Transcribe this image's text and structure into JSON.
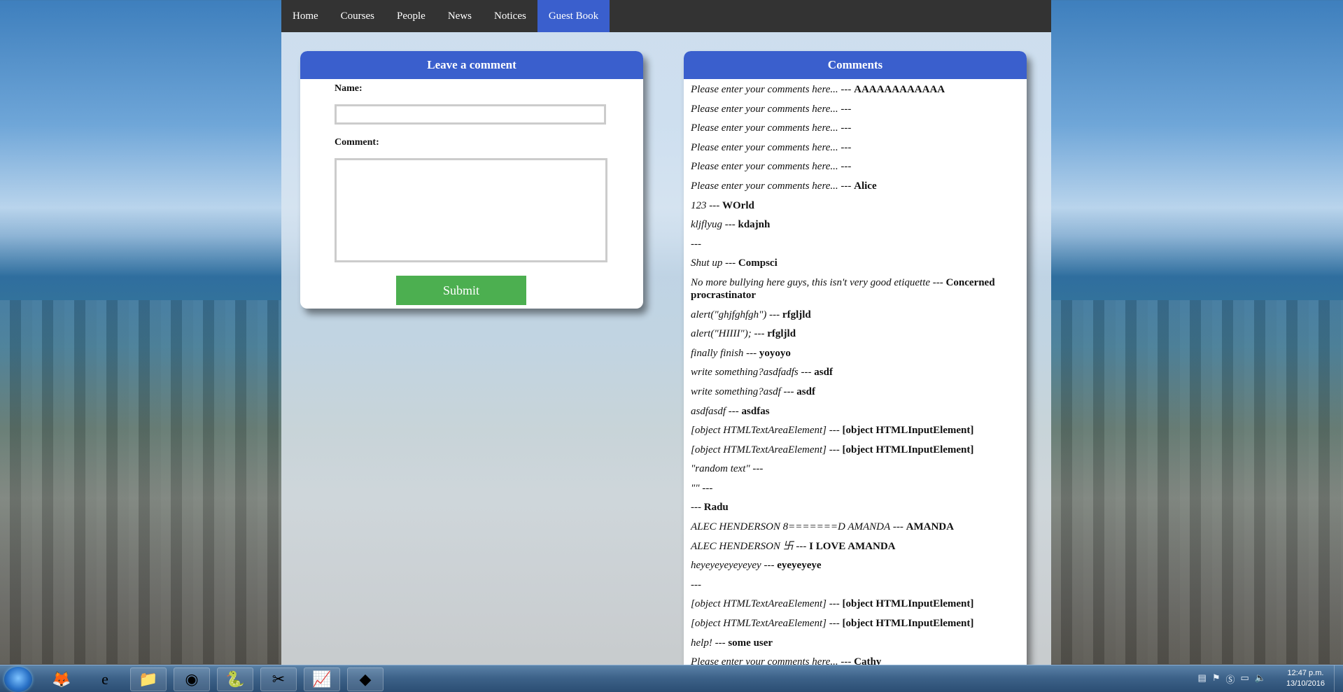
{
  "nav": {
    "items": [
      "Home",
      "Courses",
      "People",
      "News",
      "Notices",
      "Guest Book"
    ],
    "active": "Guest Book"
  },
  "leave_comment": {
    "title": "Leave a comment",
    "name_label": "Name:",
    "name_value": "",
    "comment_label": "Comment:",
    "comment_value": "",
    "submit_label": "Submit"
  },
  "comments": {
    "title": "Comments",
    "items": [
      {
        "text": "Please enter your comments here...",
        "sep": " --- ",
        "author": "AAAAAAAAAAAA"
      },
      {
        "text": "Please enter your comments here...",
        "sep": " --- ",
        "author": ""
      },
      {
        "text": "Please enter your comments here...",
        "sep": " --- ",
        "author": ""
      },
      {
        "text": "Please enter your comments here...",
        "sep": " --- ",
        "author": ""
      },
      {
        "text": "Please enter your comments here...",
        "sep": " --- ",
        "author": ""
      },
      {
        "text": "Please enter your comments here...",
        "sep": " --- ",
        "author": "Alice"
      },
      {
        "text": "123",
        "sep": " --- ",
        "author": "WOrld"
      },
      {
        "text": "kljflyug",
        "sep": " --- ",
        "author": "kdajnh"
      },
      {
        "text": "",
        "sep": " --- ",
        "author": ""
      },
      {
        "text": "Shut up",
        "sep": " --- ",
        "author": "Compsci"
      },
      {
        "text": "No more bullying here guys, this isn't very good etiquette",
        "sep": " --- ",
        "author": "Concerned procrastinator"
      },
      {
        "text": "alert(\"ghjfghfgh\")",
        "sep": " --- ",
        "author": "rfgljld"
      },
      {
        "text": "alert(\"HIIII\");",
        "sep": " --- ",
        "author": "rfgljld"
      },
      {
        "text": "finally finish",
        "sep": " --- ",
        "author": "yoyoyo"
      },
      {
        "text": "write something?asdfadfs",
        "sep": " --- ",
        "author": "asdf"
      },
      {
        "text": "write something?asdf",
        "sep": " --- ",
        "author": "asdf"
      },
      {
        "text": "asdfasdf",
        "sep": " --- ",
        "author": "asdfas"
      },
      {
        "text": "[object HTMLTextAreaElement]",
        "sep": " --- ",
        "author": "[object HTMLInputElement]"
      },
      {
        "text": "[object HTMLTextAreaElement]",
        "sep": " --- ",
        "author": "[object HTMLInputElement]"
      },
      {
        "text": "\"random text\"",
        "sep": " --- ",
        "author": ""
      },
      {
        "text": "\"\"",
        "sep": " --- ",
        "author": ""
      },
      {
        "text": "",
        "sep": " --- ",
        "author": "Radu"
      },
      {
        "text": "ALEC HENDERSON 8=======D AMANDA",
        "sep": " --- ",
        "author": "AMANDA"
      },
      {
        "text": "ALEC HENDERSON 卐",
        "sep": " --- ",
        "author": "I LOVE AMANDA"
      },
      {
        "text": "heyeyeyeyeyeyey",
        "sep": " --- ",
        "author": "eyeyeyeye"
      },
      {
        "text": "",
        "sep": " --- ",
        "author": ""
      },
      {
        "text": "[object HTMLTextAreaElement]",
        "sep": " --- ",
        "author": "[object HTMLInputElement]"
      },
      {
        "text": "[object HTMLTextAreaElement]",
        "sep": " --- ",
        "author": "[object HTMLInputElement]"
      },
      {
        "text": "help!",
        "sep": " --- ",
        "author": "some user"
      },
      {
        "text": "Please enter your comments here...",
        "sep": " --- ",
        "author": "Cathy"
      }
    ]
  },
  "taskbar": {
    "apps": [
      {
        "icon": "firefox-icon",
        "glyph": "🦊"
      },
      {
        "icon": "internet-explorer-icon",
        "glyph": "e"
      },
      {
        "icon": "file-explorer-icon",
        "glyph": "📁"
      },
      {
        "icon": "chrome-icon",
        "glyph": "◉"
      },
      {
        "icon": "python-icon",
        "glyph": "🐍"
      },
      {
        "icon": "snipping-tool-icon",
        "glyph": "✂"
      },
      {
        "icon": "chart-app-icon",
        "glyph": "📈"
      },
      {
        "icon": "visual-studio-icon",
        "glyph": "◆"
      }
    ],
    "time": "12:47 p.m.",
    "date": "13/10/2016"
  },
  "colors": {
    "nav_bg": "#333333",
    "accent": "#3a5fcd",
    "submit": "#4caf50"
  }
}
